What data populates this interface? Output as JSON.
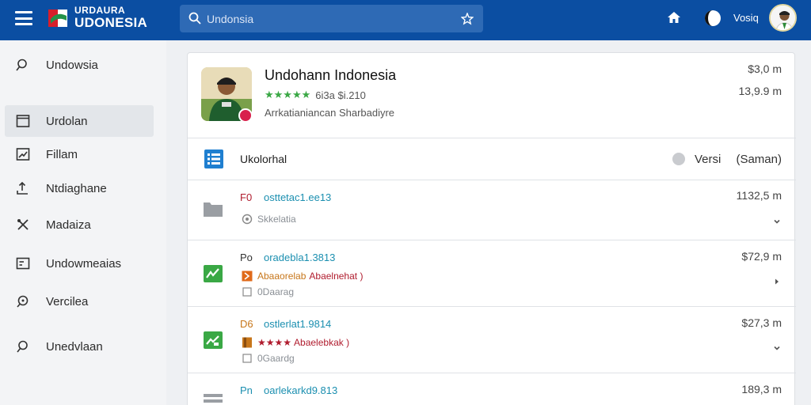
{
  "header": {
    "brand_line1": "URDAURA",
    "brand_line2": "UDONESIA",
    "search_placeholder": "Undonsia",
    "user_name": "Vosiq"
  },
  "sidebar": {
    "items": [
      {
        "label": "Undowsia",
        "icon": "search-icon",
        "active": false
      },
      {
        "label": "Urdolan",
        "icon": "window-icon",
        "active": true
      },
      {
        "label": "Fillam",
        "icon": "chart-icon",
        "active": false
      },
      {
        "label": "Ntdiaghane",
        "icon": "upload-icon",
        "active": false
      },
      {
        "label": "Madaiza",
        "icon": "tools-icon",
        "active": false
      },
      {
        "label": "Undowmeaias",
        "icon": "list-box-icon",
        "active": false
      },
      {
        "label": "Vercilea",
        "icon": "search-icon",
        "active": false
      },
      {
        "label": "Unedvlaan",
        "icon": "search-icon",
        "active": false
      }
    ]
  },
  "profile": {
    "name": "Undohann Indonesia",
    "stars": "★★★★★",
    "rating_text": "6i3a $i.210",
    "desc": "Arrkatianiancan Sharbadiyre",
    "value1": "$3,0 m",
    "value2": "13,9.9 m"
  },
  "section": {
    "label": "Ukolorhal",
    "version_label": "Versi",
    "version_value": "(Saman)"
  },
  "rows": [
    {
      "code": "F0",
      "id": "osttetac1.ee13",
      "sub": "Skkelatia",
      "amount": "1132,5 m",
      "icon": "folder-icon",
      "chevron": "chevron-down-icon"
    },
    {
      "code": "Po",
      "id": "oradebla1.3813",
      "sub_a": "Abaaorelab",
      "sub_b": "Abaelnehat )",
      "sub2": "0Daarag",
      "amount": "$72,9 m",
      "icon": "chart-icon",
      "chevron": "chevron-right-icon"
    },
    {
      "code": "D6",
      "id": "ostlerlat1.9814",
      "sub_a": "★★★★",
      "sub_b": "Abaelebkak )",
      "sub2": "0Gaardg",
      "amount": "$27,3 m",
      "icon": "chart-icon",
      "chevron": "chevron-down-icon"
    },
    {
      "code": "Pn",
      "id": "oarlekarkd9.813",
      "amount": "189,3 m",
      "icon": "grid-icon"
    }
  ],
  "colors": {
    "header": "#0b4ea2",
    "accent_green": "#3aa845",
    "link_teal": "#1b8fb0",
    "badge_red": "#d8204c"
  }
}
